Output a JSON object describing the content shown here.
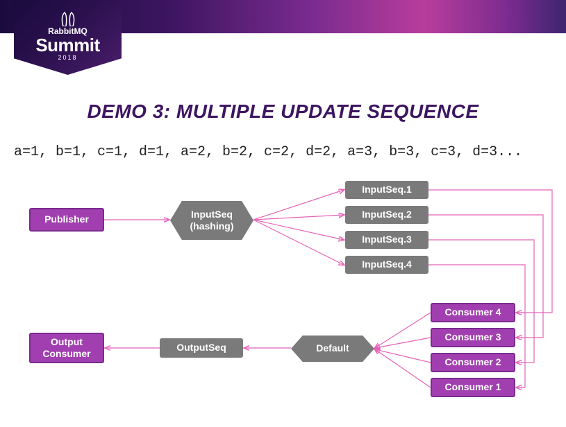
{
  "logo": {
    "brand": "RabbitMQ",
    "summit": "Summit",
    "year": "2018"
  },
  "title": "DEMO 3: MULTIPLE UPDATE SEQUENCE",
  "sequence_text": "a=1, b=1, c=1, d=1, a=2, b=2, c=2, d=2, a=3, b=3, c=3, d=3...",
  "nodes": {
    "publisher": "Publisher",
    "input_hash": "InputSeq\n(hashing)",
    "inputseq1": "InputSeq.1",
    "inputseq2": "InputSeq.2",
    "inputseq3": "InputSeq.3",
    "inputseq4": "InputSeq.4",
    "output_consumer": "Output\nConsumer",
    "outputseq": "OutputSeq",
    "default": "Default",
    "consumer1": "Consumer 1",
    "consumer2": "Consumer 2",
    "consumer3": "Consumer 3",
    "consumer4": "Consumer 4"
  },
  "colors": {
    "purple_fill": "#a23fb0",
    "purple_border": "#7a2b8f",
    "gray_fill": "#7a7a7a",
    "arrow": "#e463b8",
    "title": "#3d1560"
  },
  "edges": [
    {
      "from": "publisher",
      "to": "input_hash"
    },
    {
      "from": "input_hash",
      "to": "inputseq1"
    },
    {
      "from": "input_hash",
      "to": "inputseq2"
    },
    {
      "from": "input_hash",
      "to": "inputseq3"
    },
    {
      "from": "input_hash",
      "to": "inputseq4"
    },
    {
      "from": "inputseq1",
      "to": "consumer4"
    },
    {
      "from": "inputseq2",
      "to": "consumer3"
    },
    {
      "from": "inputseq3",
      "to": "consumer2"
    },
    {
      "from": "inputseq4",
      "to": "consumer1"
    },
    {
      "from": "consumer4",
      "to": "default"
    },
    {
      "from": "consumer3",
      "to": "default"
    },
    {
      "from": "consumer2",
      "to": "default"
    },
    {
      "from": "consumer1",
      "to": "default"
    },
    {
      "from": "default",
      "to": "outputseq"
    },
    {
      "from": "outputseq",
      "to": "output_consumer"
    }
  ]
}
